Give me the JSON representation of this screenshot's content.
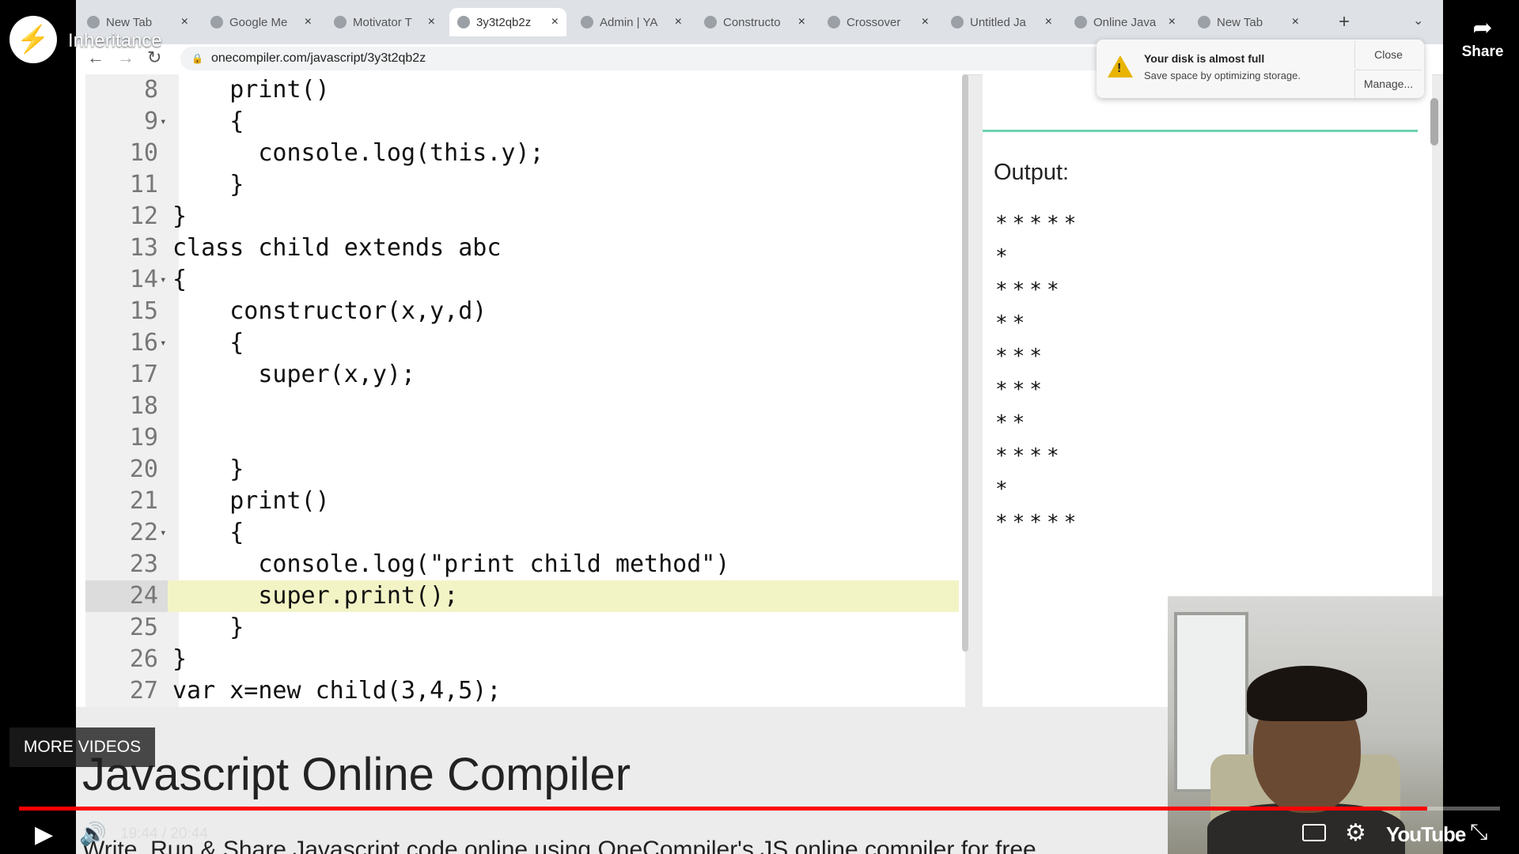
{
  "youtube": {
    "title": "Inheritance",
    "share_label": "Share",
    "more_videos": "MORE VIDEOS",
    "time": "19:44 / 20:44",
    "progress": 0.951,
    "logo_text": "YouTube"
  },
  "browser": {
    "tabs": [
      {
        "label": "New Tab",
        "active": false
      },
      {
        "label": "Google Me",
        "active": false
      },
      {
        "label": "Motivator T",
        "active": false
      },
      {
        "label": "3y3t2qb2z",
        "active": true
      },
      {
        "label": "Admin | YA",
        "active": false
      },
      {
        "label": "Constructo",
        "active": false
      },
      {
        "label": "Crossover",
        "active": false
      },
      {
        "label": "Untitled Ja",
        "active": false
      },
      {
        "label": "Online Java",
        "active": false
      },
      {
        "label": "New Tab",
        "active": false
      }
    ],
    "url": "onecompiler.com/javascript/3y3t2qb2z"
  },
  "notification": {
    "title": "Your disk is almost full",
    "subtitle": "Save space by optimizing storage.",
    "close_label": "Close",
    "manage_label": "Manage..."
  },
  "editor": {
    "highlighted_line": "24",
    "lines": [
      {
        "num": "8",
        "code": "    print()",
        "fold": false
      },
      {
        "num": "9",
        "code": "    {",
        "fold": true
      },
      {
        "num": "10",
        "code": "      console.log(this.y);",
        "fold": false
      },
      {
        "num": "11",
        "code": "    }",
        "fold": false
      },
      {
        "num": "12",
        "code": "}",
        "fold": false
      },
      {
        "num": "13",
        "code": "class child extends abc",
        "fold": false
      },
      {
        "num": "14",
        "code": "{",
        "fold": true
      },
      {
        "num": "15",
        "code": "    constructor(x,y,d)",
        "fold": false
      },
      {
        "num": "16",
        "code": "    {",
        "fold": true
      },
      {
        "num": "17",
        "code": "      super(x,y);",
        "fold": false
      },
      {
        "num": "18",
        "code": "",
        "fold": false
      },
      {
        "num": "19",
        "code": "",
        "fold": false
      },
      {
        "num": "20",
        "code": "    }",
        "fold": false
      },
      {
        "num": "21",
        "code": "    print()",
        "fold": false
      },
      {
        "num": "22",
        "code": "    {",
        "fold": true
      },
      {
        "num": "23",
        "code": "      console.log(\"print child method\")",
        "fold": false
      },
      {
        "num": "24",
        "code": "      super.print();",
        "fold": false
      },
      {
        "num": "25",
        "code": "    }",
        "fold": false
      },
      {
        "num": "26",
        "code": "}",
        "fold": false
      },
      {
        "num": "27",
        "code": "var x=new child(3,4,5);",
        "fold": false
      }
    ]
  },
  "output": {
    "title": "Output:",
    "lines": [
      "*****",
      "*",
      "****",
      "**",
      "***",
      "***",
      "**",
      "****",
      "*",
      "*****"
    ]
  },
  "page": {
    "heading": "Javascript Online Compiler",
    "subheading": "Write, Run & Share Javascript code online using OneCompiler's JS online compiler for free."
  },
  "colors": {
    "highlight": "#f3f4c6",
    "accent_green": "#6fd1b0",
    "progress_red": "#ff0000"
  }
}
